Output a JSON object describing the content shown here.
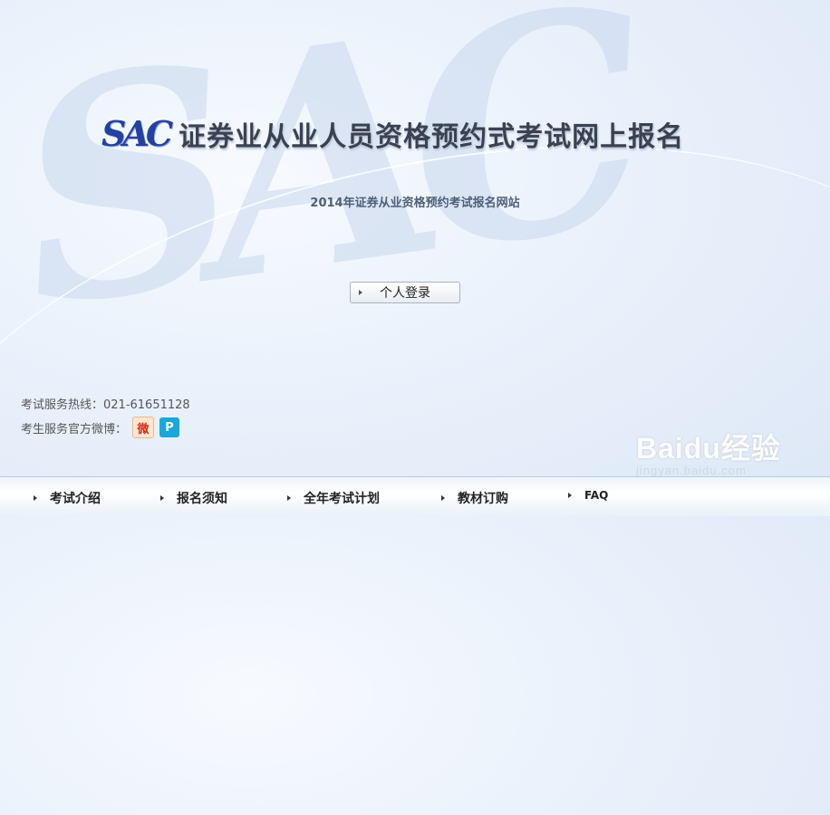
{
  "header": {
    "logo": "SAC",
    "title": "证券业从业人员资格预约式考试网上报名",
    "subtitle": "2014年证券从业资格预约考试报名网站"
  },
  "login": {
    "label": "个人登录"
  },
  "contact": {
    "hotline": "考试服务热线：021-61651128",
    "weibo_label": "考生服务官方微博：",
    "icons": [
      "sina-weibo-icon",
      "tencent-weibo-icon"
    ]
  },
  "nav": {
    "items": [
      "考试介绍",
      "报名须知",
      "全年考试计划",
      "教材订购",
      "FAQ"
    ]
  },
  "watermark": {
    "main": "Baidu经验",
    "sub": "jingyan.baidu.com"
  },
  "colors": {
    "logo": "#2341a0",
    "title": "#3a4252",
    "background": "#eaf1fb"
  }
}
